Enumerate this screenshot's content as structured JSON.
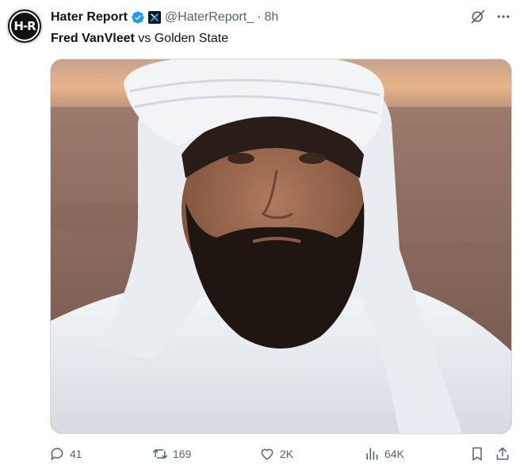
{
  "author": {
    "display_name": "Hater Report",
    "handle": "@HaterReport_",
    "separator": "·",
    "time": "8h",
    "avatar_text": "H-R",
    "verified_color": "#1d9bf0"
  },
  "tweet": {
    "text_bold": "Fred VanVleet",
    "text_rest": " vs Golden State"
  },
  "media": {
    "alt": "photo"
  },
  "actions": {
    "replies": "41",
    "retweets": "169",
    "likes": "2K",
    "views": "64K"
  },
  "icons": [
    "verified-badge-icon",
    "affiliate-x-icon",
    "grok-icon",
    "more-icon",
    "reply-icon",
    "retweet-icon",
    "like-icon",
    "views-icon",
    "bookmark-icon",
    "share-icon"
  ]
}
